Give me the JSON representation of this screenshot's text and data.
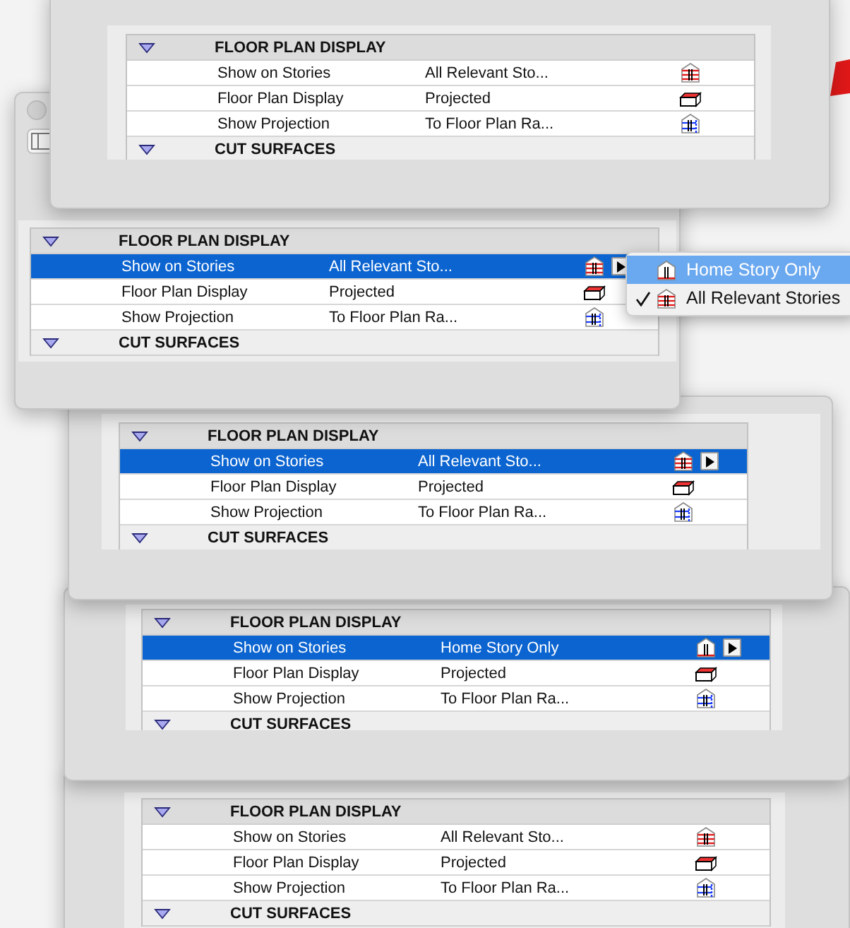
{
  "panels": [
    {
      "sections": [
        {
          "title": "FLOOR PLAN DISPLAY",
          "expanded": true,
          "rows": [
            {
              "label": "Show on Stories",
              "value": "All Relevant Sto...",
              "kind": "stories-all",
              "selected": false
            },
            {
              "label": "Floor Plan Display",
              "value": "Projected",
              "kind": "display",
              "selected": false
            },
            {
              "label": "Show Projection",
              "value": "To Floor Plan Ra...",
              "kind": "projection",
              "selected": false
            }
          ]
        },
        {
          "title": "CUT SURFACES",
          "expanded": true
        }
      ]
    },
    {
      "sections": [
        {
          "title": "FLOOR PLAN DISPLAY",
          "expanded": true,
          "rows": [
            {
              "label": "Show on Stories",
              "value": "All Relevant Sto...",
              "kind": "stories-all",
              "selected": true
            },
            {
              "label": "Floor Plan Display",
              "value": "Projected",
              "kind": "display",
              "selected": false
            },
            {
              "label": "Show Projection",
              "value": "To Floor Plan Ra...",
              "kind": "projection",
              "selected": false
            }
          ]
        },
        {
          "title": "CUT SURFACES",
          "expanded": true
        }
      ],
      "menu": {
        "items": [
          {
            "label": "Home Story Only",
            "kind": "stories-home",
            "selected": true,
            "checked": false
          },
          {
            "label": "All Relevant Stories",
            "kind": "stories-all",
            "selected": false,
            "checked": true
          }
        ]
      }
    },
    {
      "sections": [
        {
          "title": "FLOOR PLAN DISPLAY",
          "expanded": true,
          "rows": [
            {
              "label": "Show on Stories",
              "value": "All Relevant Sto...",
              "kind": "stories-all",
              "selected": true
            },
            {
              "label": "Floor Plan Display",
              "value": "Projected",
              "kind": "display",
              "selected": false
            },
            {
              "label": "Show Projection",
              "value": "To Floor Plan Ra...",
              "kind": "projection",
              "selected": false
            }
          ]
        },
        {
          "title": "CUT SURFACES",
          "expanded": true
        }
      ]
    },
    {
      "sections": [
        {
          "title": "FLOOR PLAN DISPLAY",
          "expanded": true,
          "rows": [
            {
              "label": "Show on Stories",
              "value": "Home Story Only",
              "kind": "stories-home",
              "selected": true
            },
            {
              "label": "Floor Plan Display",
              "value": "Projected",
              "kind": "display",
              "selected": false
            },
            {
              "label": "Show Projection",
              "value": "To Floor Plan Ra...",
              "kind": "projection",
              "selected": false
            }
          ]
        },
        {
          "title": "CUT SURFACES",
          "expanded": true
        }
      ]
    },
    {
      "sections": [
        {
          "title": "FLOOR PLAN DISPLAY",
          "expanded": true,
          "rows": [
            {
              "label": "Show on Stories",
              "value": "All Relevant Sto...",
              "kind": "stories-all",
              "selected": false
            },
            {
              "label": "Floor Plan Display",
              "value": "Projected",
              "kind": "display",
              "selected": false
            },
            {
              "label": "Show Projection",
              "value": "To Floor Plan Ra...",
              "kind": "projection",
              "selected": false
            }
          ]
        },
        {
          "title": "CUT SURFACES",
          "expanded": true
        }
      ]
    }
  ]
}
